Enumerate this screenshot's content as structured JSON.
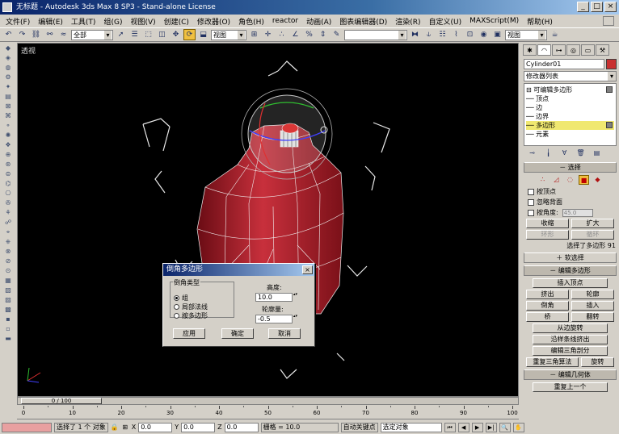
{
  "window": {
    "title": "无标题   - Autodesk 3ds Max 8 SP3  - Stand-alone License",
    "controls": [
      "_",
      "□",
      "×"
    ]
  },
  "menubar": [
    "文件(F)",
    "编辑(E)",
    "工具(T)",
    "组(G)",
    "视图(V)",
    "创建(C)",
    "修改器(O)",
    "角色(H)",
    "reactor",
    "动画(A)",
    "图表编辑器(D)",
    "渲染(R)",
    "自定义(U)",
    "MAXScript(M)",
    "帮助(H)"
  ],
  "toolbar": {
    "selection_filter": "全部",
    "ref_coord": "视图",
    "named_selection": "",
    "view_dropdown": "视图"
  },
  "viewport": {
    "label": "透视"
  },
  "command_panel": {
    "object_name": "Cylinder01",
    "object_color": "#c83030",
    "modifier_list": "修改器列表",
    "stack": [
      {
        "label": "⊟ 可编辑多边形",
        "selected": false
      },
      {
        "label": "   ── 顶点",
        "selected": false
      },
      {
        "label": "   ── 边",
        "selected": false
      },
      {
        "label": "   ── 边界",
        "selected": false
      },
      {
        "label": "   ── 多边形",
        "selected": true
      },
      {
        "label": "   ── 元素",
        "selected": false
      }
    ],
    "selection_rollout": "选择",
    "by_vertex": "按顶点",
    "ignore_backfacing": "忽略背面",
    "by_angle": "按角度:",
    "angle_value": "45.0",
    "shrink": "收缩",
    "grow": "扩大",
    "ring": "环形",
    "loop": "循环",
    "selected_count": "选择了多边形 91",
    "soft_selection": "软选择",
    "edit_polygons": "编辑多边形",
    "insert_vertex": "插入顶点",
    "extrude": "挤出",
    "outline": "轮廓",
    "bevel": "倒角",
    "inset": "插入",
    "bridge": "桥",
    "flip": "翻转",
    "hinge_from_edge": "从边旋转",
    "extrude_along_spline": "沿样条线挤出",
    "edit_triangulation": "编辑三角剖分",
    "retriangulate": "重复三角算法",
    "turn": "旋转",
    "edit_geometry": "编辑几何体",
    "repeat_last": "重复上一个"
  },
  "dialog": {
    "title": "倒角多边形",
    "group_label": "倒角类型",
    "radio_group": "组",
    "radio_local": "局部法线",
    "radio_by_polygon": "按多边形",
    "height_label": "高度:",
    "height_value": "10.0",
    "outline_label": "轮廓量:",
    "outline_value": "-0.5",
    "apply": "应用",
    "ok": "确定",
    "cancel": "取消"
  },
  "timeline": {
    "slider": "0 / 100",
    "ticks": [
      "0",
      "10",
      "20",
      "30",
      "40",
      "50",
      "60",
      "70",
      "80",
      "90",
      "100"
    ]
  },
  "statusbar": {
    "selected": "选择了 1 个 对象",
    "x_label": "X",
    "x_value": "0.0",
    "y_label": "Y",
    "y_value": "0.0",
    "z_label": "Z",
    "z_value": "0.0",
    "grid": "栅格 = 10.0",
    "auto_key": "自动关键点",
    "set_key_filter": "选定对象"
  }
}
